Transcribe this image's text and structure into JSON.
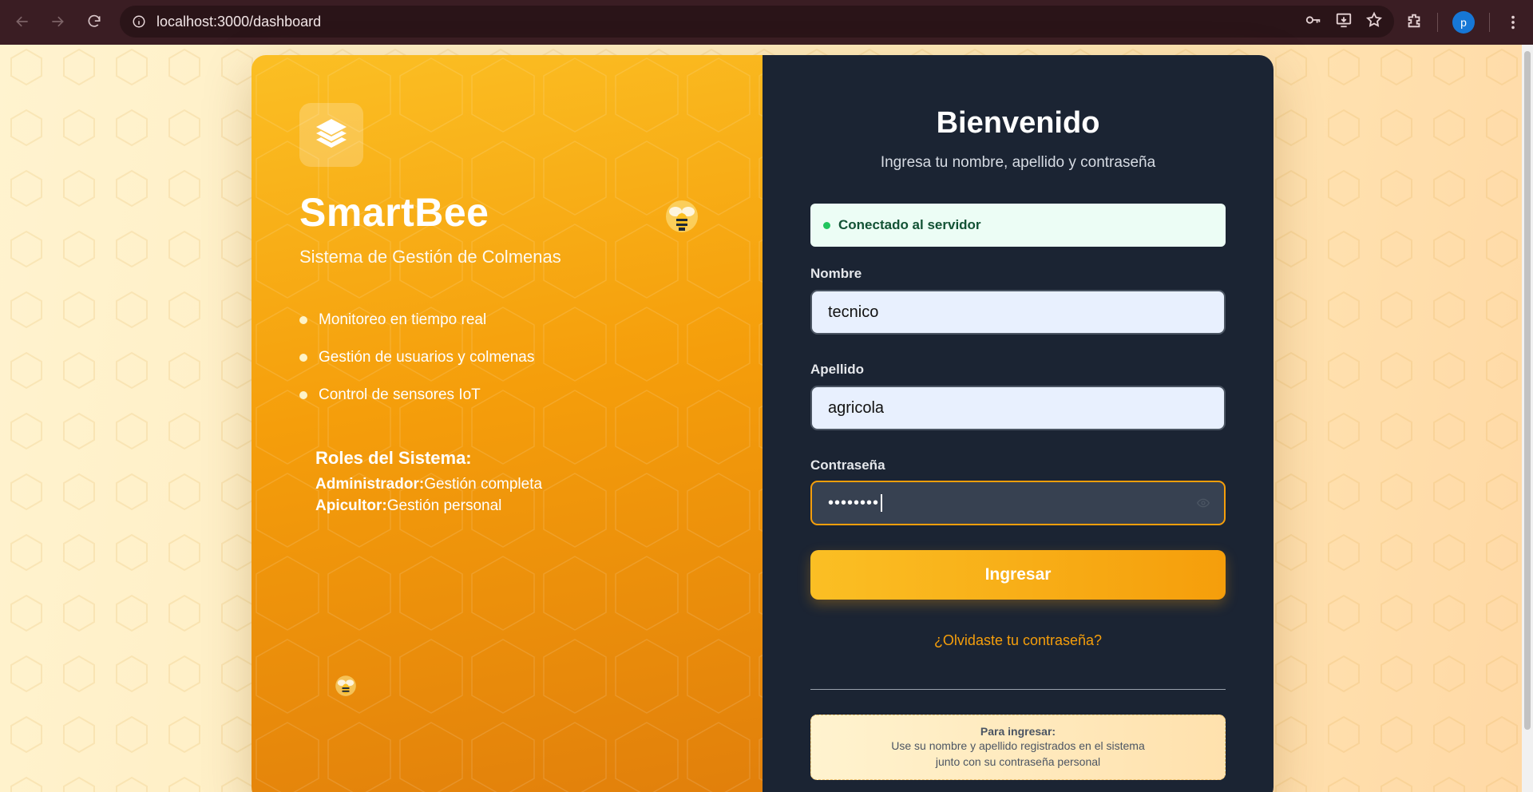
{
  "browser": {
    "url": "localhost:3000/dashboard",
    "profile_initial": "p"
  },
  "brand": {
    "name": "SmartBee",
    "subtitle": "Sistema de Gestión de Colmenas",
    "features": [
      "Monitoreo en tiempo real",
      "Gestión de usuarios y colmenas",
      "Control de sensores IoT"
    ],
    "roles_title": "Roles del Sistema:",
    "roles": [
      {
        "name": "Administrador:",
        "desc": "Gestión completa"
      },
      {
        "name": "Apicultor:",
        "desc": "Gestión personal"
      }
    ]
  },
  "login": {
    "title": "Bienvenido",
    "subtitle": "Ingresa tu nombre, apellido y contraseña",
    "status": "Conectado al servidor",
    "name_label": "Nombre",
    "name_value": "tecnico",
    "lastname_label": "Apellido",
    "lastname_value": "agricola",
    "password_label": "Contraseña",
    "password_value": "••••••••",
    "submit_label": "Ingresar",
    "forgot_label": "¿Olvidaste tu contraseña?",
    "hint_title": "Para ingresar:",
    "hint_line1": "Use su nombre y apellido registrados en el sistema",
    "hint_line2": "junto con su contraseña personal"
  },
  "colors": {
    "accent": "#f59e0b",
    "panel_dark": "#1b2433",
    "status_ok": "#22c55e"
  }
}
